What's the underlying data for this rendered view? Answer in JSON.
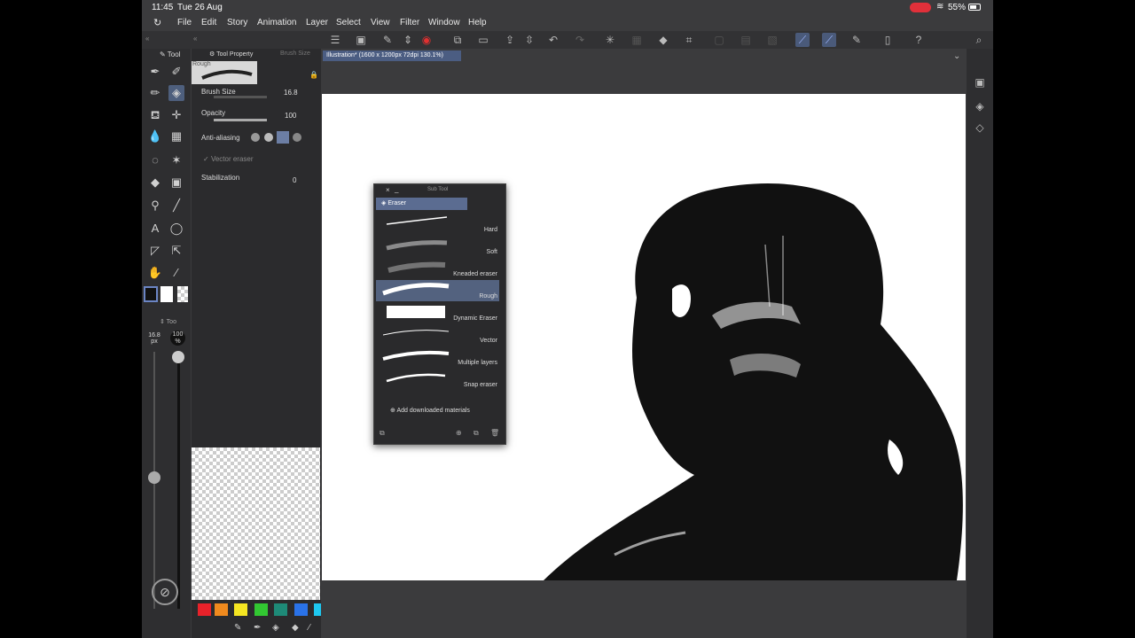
{
  "status": {
    "time": "11:45",
    "date": "Tue 26 Aug",
    "battery": "55%"
  },
  "menu": [
    "File",
    "Edit",
    "Story",
    "Animation",
    "Layer",
    "Select",
    "View",
    "Filter",
    "Window",
    "Help"
  ],
  "tool_panel": {
    "tab_tool": "Tool",
    "tab_tool_property": "Tool Property",
    "tab_brush_size": "Brush Size",
    "tool_name": "Rough",
    "brush_size_label": "Brush Size",
    "brush_size_value": "16.8",
    "opacity_label": "Opacity",
    "opacity_value": "100",
    "anti_aliasing_label": "Anti-aliasing",
    "vector_eraser_label": "Vector eraser",
    "stabilization_label": "Stabilization",
    "stabilization_value": "0"
  },
  "size_readout": {
    "brush": "16.8",
    "brush_unit": "px",
    "opacity": "100",
    "opacity_unit": "%"
  },
  "sub_tool": {
    "title": "Sub Tool",
    "group": "Eraser",
    "items": [
      "Hard",
      "Soft",
      "Kneaded eraser",
      "Rough",
      "Dynamic Eraser",
      "Vector",
      "Multiple layers",
      "Snap eraser"
    ],
    "selected": "Rough",
    "add_materials": "Add downloaded materials"
  },
  "document": {
    "tab": "Illustration* (1600 x 1200px 72dpi 130.1%)"
  },
  "colors": {
    "accent": "#4e5f7d",
    "selection": "#53627f"
  },
  "palette": [
    "#e8222a",
    "#f08a1e",
    "#f5e622",
    "#32c832",
    "#1e8a78",
    "#2a72e8",
    "#1ec8f0"
  ]
}
